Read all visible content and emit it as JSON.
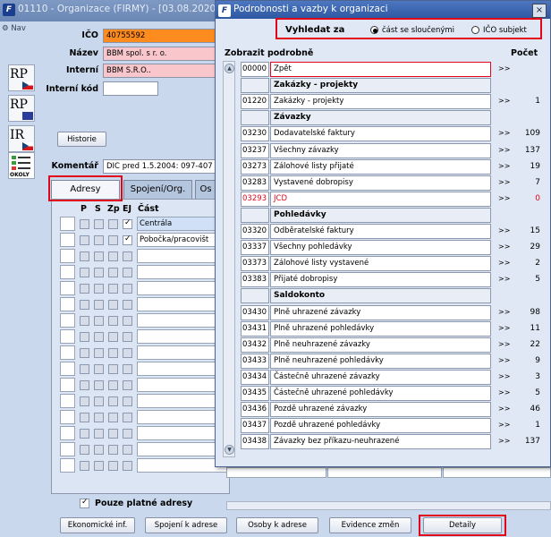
{
  "background_window": {
    "title": "01110 - Organizace (FIRMY) - [03.08.2020]",
    "app_icon": "F",
    "nav_label": "Nav",
    "side_icons": [
      {
        "label": "RP",
        "flag": "cz"
      },
      {
        "label": "RP",
        "flag": "eu"
      },
      {
        "label": "IR",
        "flag": "cz"
      },
      {
        "label": "OKOLY",
        "flag": "checklist"
      }
    ],
    "fields": {
      "ico_label": "IČO",
      "ico_value": "40755592",
      "nazev_label": "Název",
      "nazev_value": "BBM spol. s r. o.",
      "interni_label": "Interní",
      "interni_value": "BBM S.R.O..",
      "interni_kod_label": "Interní kód",
      "interni_kod_value": "",
      "komentar_label": "Komentář",
      "komentar_value": "DIC pred 1.5.2004: 097-407"
    },
    "historie_button": "Historie",
    "tabs": [
      "Adresy",
      "Spojení/Org.",
      "Os"
    ],
    "grid_headers": [
      "P",
      "S",
      "Zp",
      "EJ",
      "Část"
    ],
    "grid_rows": [
      {
        "name": "Centrála",
        "checked": true,
        "selected": true
      },
      {
        "name": "Pobočka/pracovišt",
        "checked": true,
        "selected": false
      }
    ],
    "pouze_platne": "Pouze platné adresy",
    "bottom_buttons": [
      "Ekonomické inf.",
      "Spojení k adrese",
      "Osoby k adrese",
      "Evidence změn",
      "Detaily"
    ]
  },
  "dialog": {
    "title": "Podrobnosti a vazby k organizaci",
    "close_icon": "×",
    "vyhledat_label": "Vyhledat za",
    "radio_1": "část se sloučenými",
    "radio_2": "IČO subjekt",
    "col_header_left": "Zobrazit podrobně",
    "col_header_right": "Počet",
    "arrow": ">>",
    "rows": [
      {
        "code": "00000",
        "name": "Zpět",
        "count": "",
        "type": "item",
        "focus": true
      },
      {
        "code": "",
        "name": "Zakázky - projekty",
        "count": "",
        "type": "header"
      },
      {
        "code": "01220",
        "name": "Zakázky - projekty",
        "count": "1",
        "type": "item"
      },
      {
        "code": "",
        "name": "Závazky",
        "count": "",
        "type": "header"
      },
      {
        "code": "03230",
        "name": "Dodavatelské faktury",
        "count": "109",
        "type": "item"
      },
      {
        "code": "03237",
        "name": "Všechny závazky",
        "count": "137",
        "type": "item"
      },
      {
        "code": "03273",
        "name": "Zálohové listy přijaté",
        "count": "19",
        "type": "item"
      },
      {
        "code": "03283",
        "name": "Vystavené dobropisy",
        "count": "7",
        "type": "item"
      },
      {
        "code": "03293",
        "name": "JCD",
        "count": "0",
        "type": "item",
        "red": true
      },
      {
        "code": "",
        "name": "Pohledávky",
        "count": "",
        "type": "header"
      },
      {
        "code": "03320",
        "name": "Odběratelské faktury",
        "count": "15",
        "type": "item"
      },
      {
        "code": "03337",
        "name": "Všechny pohledávky",
        "count": "29",
        "type": "item"
      },
      {
        "code": "03373",
        "name": "Zálohové listy vystavené",
        "count": "2",
        "type": "item"
      },
      {
        "code": "03383",
        "name": "Přijaté dobropisy",
        "count": "5",
        "type": "item"
      },
      {
        "code": "",
        "name": "Saldokonto",
        "count": "",
        "type": "header"
      },
      {
        "code": "03430",
        "name": "Plně uhrazené závazky",
        "count": "98",
        "type": "item"
      },
      {
        "code": "03431",
        "name": "Plně uhrazené pohledávky",
        "count": "11",
        "type": "item"
      },
      {
        "code": "03432",
        "name": "Plně neuhrazené závazky",
        "count": "22",
        "type": "item"
      },
      {
        "code": "03433",
        "name": "Plně neuhrazené pohledávky",
        "count": "9",
        "type": "item"
      },
      {
        "code": "03434",
        "name": "Částečně uhrazené závazky",
        "count": "3",
        "type": "item"
      },
      {
        "code": "03435",
        "name": "Částečně uhrazené pohledávky",
        "count": "5",
        "type": "item"
      },
      {
        "code": "03436",
        "name": "Pozdě uhrazené závazky",
        "count": "46",
        "type": "item"
      },
      {
        "code": "03437",
        "name": "Pozdě uhrazené pohledávky",
        "count": "1",
        "type": "item"
      },
      {
        "code": "03438",
        "name": "Závazky bez příkazu-neuhrazené",
        "count": "137",
        "type": "item"
      }
    ]
  },
  "colors": {
    "highlight": "#e2061b",
    "ico_field": "#fe8b1e",
    "pink_field": "#f9c6cc"
  }
}
